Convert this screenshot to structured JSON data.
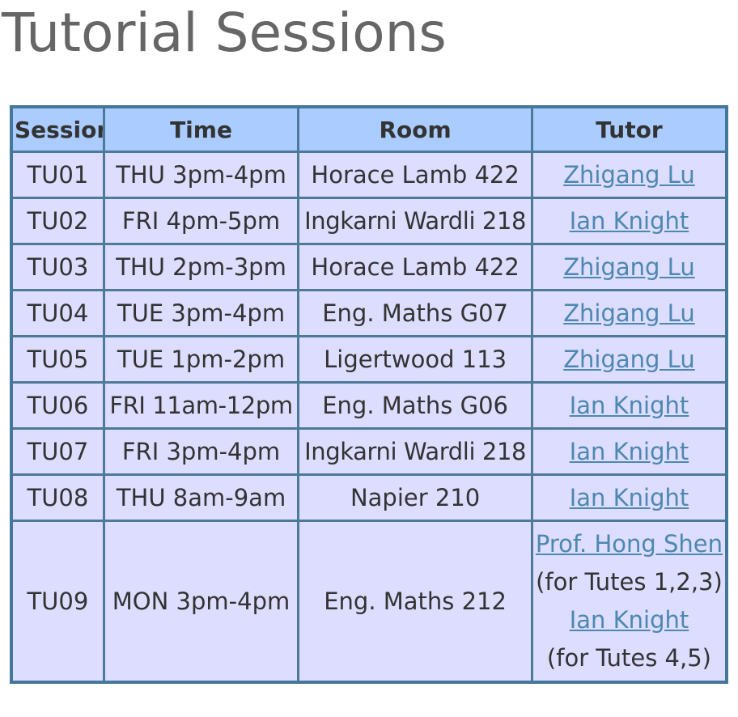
{
  "page": {
    "title": "Tutorial Sessions"
  },
  "table": {
    "headers": {
      "session": "Session",
      "time": "Time",
      "room": "Room",
      "tutor": "Tutor"
    },
    "rows": [
      {
        "session": "TU01",
        "time": "THU 3pm-4pm",
        "room": "Horace Lamb 422",
        "tutor": "Zhigang Lu"
      },
      {
        "session": "TU02",
        "time": "FRI 4pm-5pm",
        "room": "Ingkarni Wardli 218",
        "tutor": "Ian Knight"
      },
      {
        "session": "TU03",
        "time": "THU 2pm-3pm",
        "room": "Horace Lamb 422",
        "tutor": "Zhigang Lu"
      },
      {
        "session": "TU04",
        "time": "TUE 3pm-4pm",
        "room": "Eng. Maths G07",
        "tutor": "Zhigang Lu"
      },
      {
        "session": "TU05",
        "time": "TUE 1pm-2pm",
        "room": "Ligertwood 113",
        "tutor": "Zhigang Lu"
      },
      {
        "session": "TU06",
        "time": "FRI 11am-12pm",
        "room": "Eng. Maths G06",
        "tutor": "Ian Knight"
      },
      {
        "session": "TU07",
        "time": "FRI 3pm-4pm",
        "room": "Ingkarni Wardli 218",
        "tutor": "Ian Knight"
      },
      {
        "session": "TU08",
        "time": "THU 8am-9am",
        "room": "Napier 210",
        "tutor": "Ian Knight"
      }
    ],
    "last_row": {
      "session": "TU09",
      "time": "MON 3pm-4pm",
      "room": "Eng. Maths 212",
      "tutor_1": "Prof. Hong Shen",
      "tutor_1_note": "(for Tutes 1,2,3)",
      "tutor_2": "Ian Knight",
      "tutor_2_note": "(for Tutes 4,5)"
    }
  },
  "colors": {
    "header_bg": "#aaccff",
    "cell_bg": "#ddddff",
    "border": "#4d7a99",
    "link": "#4d88b0",
    "title": "#666666"
  }
}
